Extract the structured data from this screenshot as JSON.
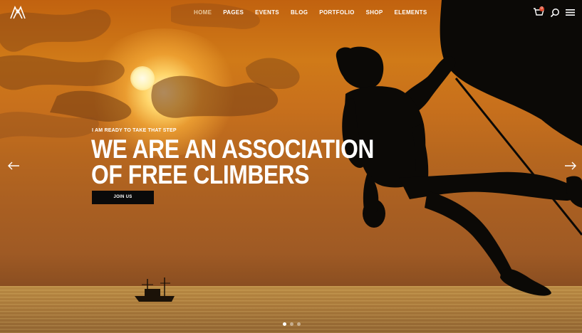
{
  "nav": {
    "items": [
      {
        "label": "HOME",
        "active": true
      },
      {
        "label": "PAGES",
        "active": false
      },
      {
        "label": "EVENTS",
        "active": false
      },
      {
        "label": "BLOG",
        "active": false
      },
      {
        "label": "PORTFOLIO",
        "active": false
      },
      {
        "label": "SHOP",
        "active": false
      },
      {
        "label": "ELEMENTS",
        "active": false
      }
    ],
    "cart_count": "0"
  },
  "hero": {
    "kicker": "I AM READY TO TAKE THAT STEP",
    "headline_line1": "WE ARE AN ASSOCIATION",
    "headline_line2": "OF FREE CLIMBERS",
    "cta_label": "JOIN US"
  },
  "slider": {
    "total_slides": 3,
    "active_slide": 1
  },
  "icons": [
    "logo-icon",
    "cart-icon",
    "search-icon",
    "menu-icon",
    "arrow-left-icon",
    "arrow-right-icon"
  ],
  "colors": {
    "active_nav": "#e8c79b",
    "cta_background": "#0a0a0a",
    "badge": "#e0492d"
  }
}
